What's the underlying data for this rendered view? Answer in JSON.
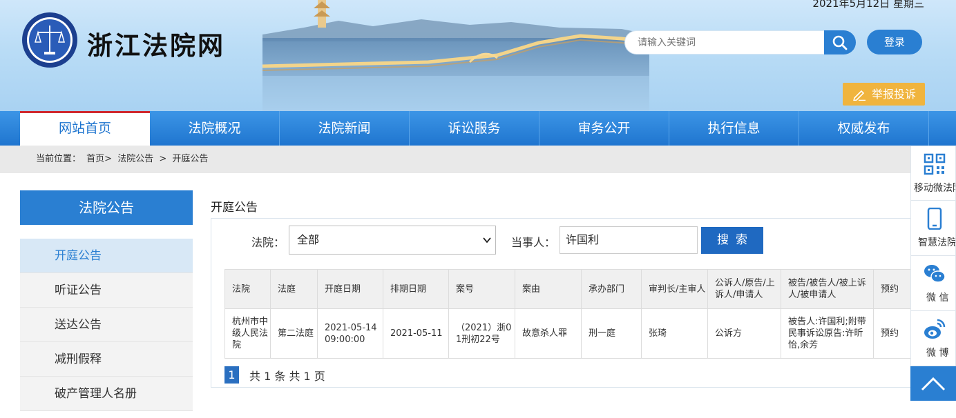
{
  "header": {
    "date": "2021年5月12日 星期三",
    "site_title": "浙江法院网",
    "search_placeholder": "请输入关键词",
    "login_label": "登录",
    "report_label": "举报投诉"
  },
  "nav": {
    "items": [
      "网站首页",
      "法院概况",
      "法院新闻",
      "诉讼服务",
      "审务公开",
      "执行信息",
      "权威发布"
    ],
    "active_index": 0
  },
  "breadcrumb": {
    "prefix": "当前位置：",
    "items": [
      "首页>",
      "法院公告",
      ">",
      "开庭公告"
    ]
  },
  "sidebar": {
    "title": "法院公告",
    "items": [
      "开庭公告",
      "听证公告",
      "送达公告",
      "减刑假释",
      "破产管理人名册"
    ],
    "active_index": 0
  },
  "main": {
    "title": "开庭公告",
    "court_label": "法院：",
    "court_value": "全部",
    "party_label": "当事人：",
    "party_value": "许国利",
    "search_label": "搜索",
    "table": {
      "headers": [
        "法院",
        "法庭",
        "开庭日期",
        "排期日期",
        "案号",
        "案由",
        "承办部门",
        "审判长/主审人",
        "公诉人/原告/上诉人/申请人",
        "被告/被告人/被上诉人/被申请人",
        "预约"
      ],
      "rows": [
        [
          "杭州市中级人民法院",
          "第二法庭",
          "2021-05-14 09:00:00",
          "2021-05-11",
          "（2021）浙01刑初22号",
          "故意杀人罪",
          "刑一庭",
          "张琦",
          "公诉方",
          "被告人:许国利;附带民事诉讼原告:许昕怡,余芳",
          "预约"
        ]
      ]
    },
    "pager": {
      "current": "1",
      "info": "共 1 条 共 1 页"
    }
  },
  "float_bar": {
    "items": [
      "移动微法院",
      "智慧法院",
      "微 信",
      "微 博"
    ]
  },
  "colors": {
    "brand_blue": "#2a7fd2",
    "nav_blue": "#1f75cf",
    "report_orange": "#f0b43e",
    "active_red": "#d0282e"
  }
}
